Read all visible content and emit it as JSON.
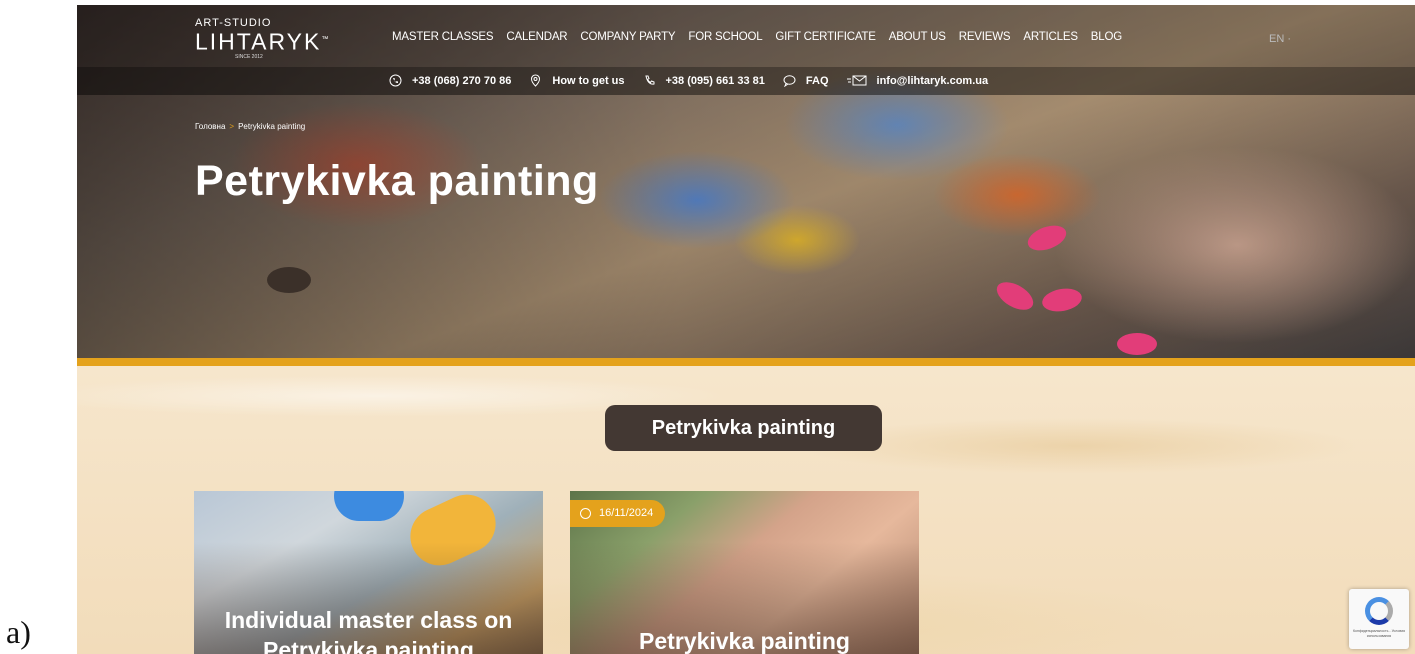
{
  "gutter_label": "a)",
  "logo": {
    "top": "ART-STUDIO",
    "main": "LIHTARYK",
    "tm": "™",
    "since": "SINCE 2012"
  },
  "nav": {
    "items": [
      {
        "label": "MASTER CLASSES"
      },
      {
        "label": "CALENDAR"
      },
      {
        "label": "COMPANY PARTY"
      },
      {
        "label": "FOR SCHOOL"
      },
      {
        "label": "GIFT CERTIFICATE"
      },
      {
        "label": "ABOUT US"
      },
      {
        "label": "REVIEWS"
      },
      {
        "label": "ARTICLES"
      },
      {
        "label": "BLOG"
      }
    ],
    "lang": "EN ·"
  },
  "contacts": {
    "phone1": "+38 (068) 270 70 86",
    "directions": "How to get us",
    "phone2": "+38 (095) 661 33 81",
    "faq": "FAQ",
    "email": "info@lihtaryk.com.ua"
  },
  "breadcrumb": {
    "home": "Головна",
    "separator": ">",
    "current": "Petrykivka painting"
  },
  "hero": {
    "title": "Petrykivka painting"
  },
  "section": {
    "title": "Petrykivka painting"
  },
  "cards": [
    {
      "title": "Individual master class on Petrykivka painting"
    },
    {
      "date": "16/11/2024",
      "title": "Petrykivka painting"
    }
  ],
  "recaptcha": {
    "text": "Конфиденциальность - Условия использования"
  },
  "colors": {
    "accent": "#e4a21c",
    "title_bg": "#433833",
    "pink_nail": "#e23d79"
  }
}
